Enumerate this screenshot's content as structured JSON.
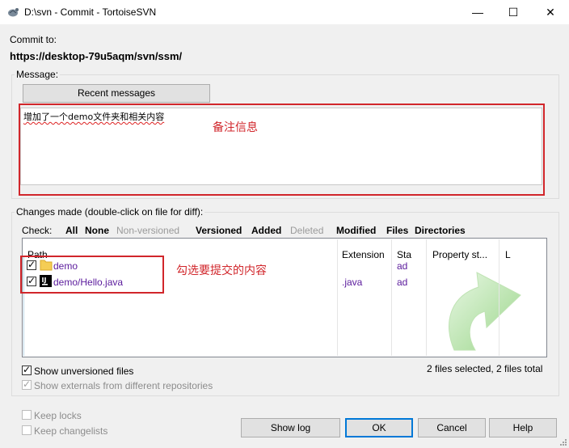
{
  "window": {
    "title": "D:\\svn - Commit - TortoiseSVN",
    "minimize": "—",
    "maximize": "☐",
    "close": "✕"
  },
  "commit_to": {
    "label": "Commit to:",
    "url": "https://desktop-79u5aqm/svn/ssm/"
  },
  "message": {
    "group_label": "Message:",
    "recent_button": "Recent messages",
    "text": "增加了一个demo文件夹和相关内容",
    "annotation": "备注信息"
  },
  "changes": {
    "group_label": "Changes made (double-click on file for diff):",
    "check_label": "Check:",
    "filters": [
      {
        "label": "All",
        "enabled": true
      },
      {
        "label": "None",
        "enabled": true
      },
      {
        "label": "Non-versioned",
        "enabled": false
      },
      {
        "label": "Versioned",
        "enabled": true
      },
      {
        "label": "Added",
        "enabled": true
      },
      {
        "label": "Deleted",
        "enabled": false
      },
      {
        "label": "Modified",
        "enabled": true
      },
      {
        "label": "Files",
        "enabled": true
      },
      {
        "label": "Directories",
        "enabled": true
      }
    ],
    "columns": [
      "Path",
      "Extension",
      "Sta",
      "Property st...",
      "L"
    ],
    "rows": [
      {
        "checked": true,
        "icon": "folder-icon",
        "path": "demo",
        "extension": "",
        "status": "ad"
      },
      {
        "checked": true,
        "icon": "intellij-file-icon",
        "path": "demo/Hello.java",
        "extension": ".java",
        "status": "ad"
      }
    ],
    "annotation": "勾选要提交的内容",
    "show_unversioned": "Show unversioned files",
    "show_externals": "Show externals from different repositories",
    "summary": "2 files selected, 2 files total"
  },
  "options": {
    "keep_locks": "Keep locks",
    "keep_changelists": "Keep changelists"
  },
  "buttons": {
    "show_log": "Show log",
    "ok": "OK",
    "cancel": "Cancel",
    "help": "Help"
  },
  "colors": {
    "annotation_red": "#d1262b",
    "added_purple": "#5a1a9c",
    "accent_blue": "#0078d7"
  }
}
